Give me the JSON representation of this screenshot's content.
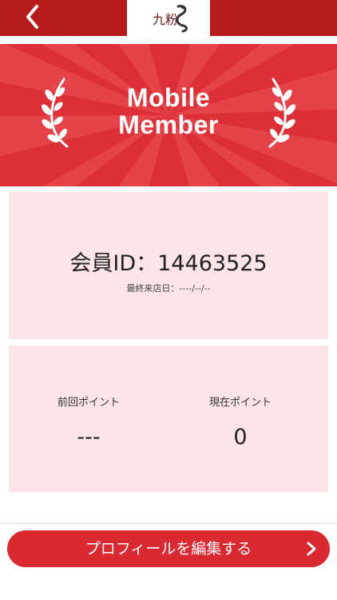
{
  "header": {
    "logo_text": "九粉"
  },
  "banner": {
    "line1": "Mobile",
    "line2": "Member"
  },
  "member": {
    "id_text": "会員ID：14463525",
    "last_visit": "最終来店日：----/--/--"
  },
  "points": {
    "previous_label": "前回ポイント",
    "previous_value": "---",
    "current_label": "現在ポイント",
    "current_value": "0"
  },
  "footer": {
    "edit_profile_label": "プロフィールを編集する"
  },
  "colors": {
    "header_red": "#b71c1c",
    "banner_red": "#dd2f37",
    "card_pink": "#fce4e8",
    "button_red": "#d92a32"
  }
}
